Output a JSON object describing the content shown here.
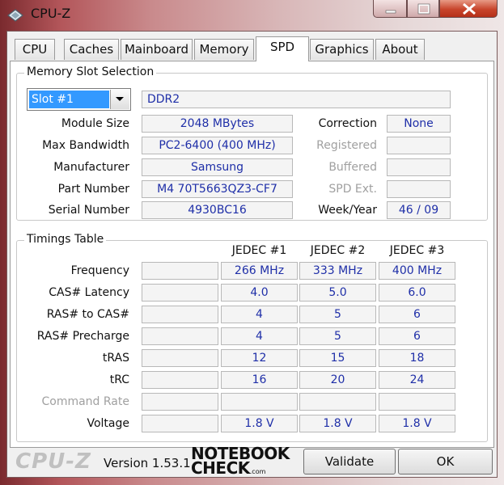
{
  "window": {
    "title": "CPU-Z"
  },
  "tabs": [
    {
      "label": "CPU"
    },
    {
      "label": "Caches"
    },
    {
      "label": "Mainboard"
    },
    {
      "label": "Memory"
    },
    {
      "label": "SPD",
      "active": true
    },
    {
      "label": "Graphics"
    },
    {
      "label": "About"
    }
  ],
  "memory_slot": {
    "group_label": "Memory Slot Selection",
    "selected_slot": "Slot #1",
    "memory_type": "DDR2",
    "module_size": {
      "label": "Module Size",
      "value": "2048 MBytes"
    },
    "max_bandwidth": {
      "label": "Max Bandwidth",
      "value": "PC2-6400 (400 MHz)"
    },
    "manufacturer": {
      "label": "Manufacturer",
      "value": "Samsung"
    },
    "part_number": {
      "label": "Part Number",
      "value": "M4 70T5663QZ3-CF7"
    },
    "serial_number": {
      "label": "Serial Number",
      "value": "4930BC16"
    },
    "correction": {
      "label": "Correction",
      "value": "None"
    },
    "registered": {
      "label": "Registered",
      "value": ""
    },
    "buffered": {
      "label": "Buffered",
      "value": ""
    },
    "spd_ext": {
      "label": "SPD Ext.",
      "value": ""
    },
    "week_year": {
      "label": "Week/Year",
      "value": "46 / 09"
    }
  },
  "timings": {
    "group_label": "Timings Table",
    "columns": [
      "",
      "JEDEC #1",
      "JEDEC #2",
      "JEDEC #3"
    ],
    "rows": [
      {
        "label": "Frequency",
        "values": [
          "",
          "266 MHz",
          "333 MHz",
          "400 MHz"
        ],
        "disabled": false
      },
      {
        "label": "CAS# Latency",
        "values": [
          "",
          "4.0",
          "5.0",
          "6.0"
        ],
        "disabled": false
      },
      {
        "label": "RAS# to CAS#",
        "values": [
          "",
          "4",
          "5",
          "6"
        ],
        "disabled": false
      },
      {
        "label": "RAS# Precharge",
        "values": [
          "",
          "4",
          "5",
          "6"
        ],
        "disabled": false
      },
      {
        "label": "tRAS",
        "values": [
          "",
          "12",
          "15",
          "18"
        ],
        "disabled": false
      },
      {
        "label": "tRC",
        "values": [
          "",
          "16",
          "20",
          "24"
        ],
        "disabled": false
      },
      {
        "label": "Command Rate",
        "values": [
          "",
          "",
          "",
          ""
        ],
        "disabled": true
      },
      {
        "label": "Voltage",
        "values": [
          "",
          "1.8 V",
          "1.8 V",
          "1.8 V"
        ],
        "disabled": false
      }
    ]
  },
  "footer": {
    "logo": "CPU-Z",
    "version": "Version 1.53.1",
    "watermark_line1": "NOTEBOOK",
    "watermark_line2": "CHECK",
    "watermark_suffix": ".com",
    "validate_label": "Validate",
    "ok_label": "OK"
  },
  "colors": {
    "value_text": "#1f2fa8",
    "selection": "#3399ff",
    "close_button": "#c8442b"
  }
}
